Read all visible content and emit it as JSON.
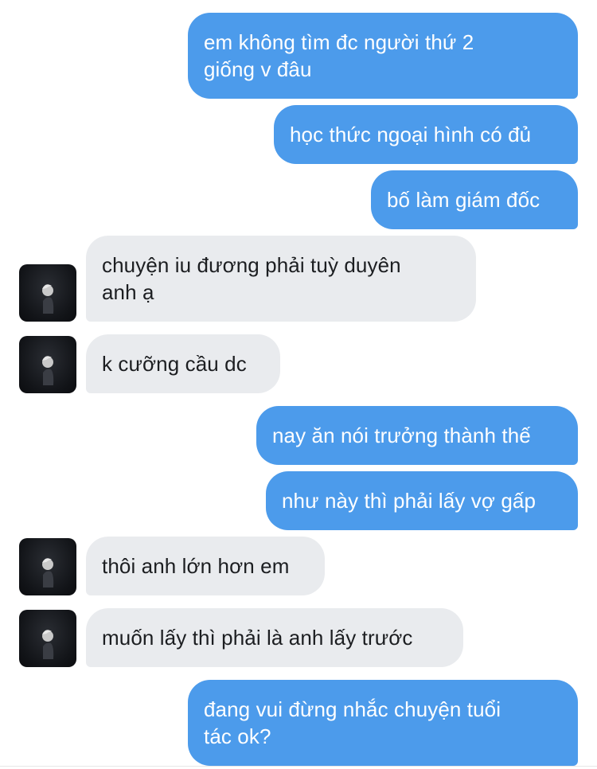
{
  "colors": {
    "sent_bubble": "#4c9beb",
    "received_bubble": "#e9ebee",
    "sent_text": "#ffffff",
    "received_text": "#1c1e21"
  },
  "messages": [
    {
      "side": "sent",
      "text": "em không tìm đc người thứ 2\ngiống v đâu"
    },
    {
      "side": "sent",
      "text": "học thức ngoại hình có đủ"
    },
    {
      "side": "sent",
      "text": "bố làm giám đốc"
    },
    {
      "side": "received",
      "text": "chuyện iu đương phải tuỳ duyên\nanh ạ",
      "avatar_icon": "profile-photo-icon"
    },
    {
      "side": "received",
      "text": "k cưỡng cầu dc",
      "avatar_icon": "profile-photo-icon"
    },
    {
      "side": "sent",
      "text": "nay ăn nói trưởng thành thế"
    },
    {
      "side": "sent",
      "text": "như này thì phải lấy vợ gấp"
    },
    {
      "side": "received",
      "text": "thôi anh lớn hơn em",
      "avatar_icon": "profile-photo-icon"
    },
    {
      "side": "received",
      "text": "muốn lấy thì phải là anh lấy trước",
      "avatar_icon": "profile-photo-icon"
    },
    {
      "side": "sent",
      "text": "đang vui đừng nhắc chuyện tuổi\ntác ok?"
    }
  ]
}
